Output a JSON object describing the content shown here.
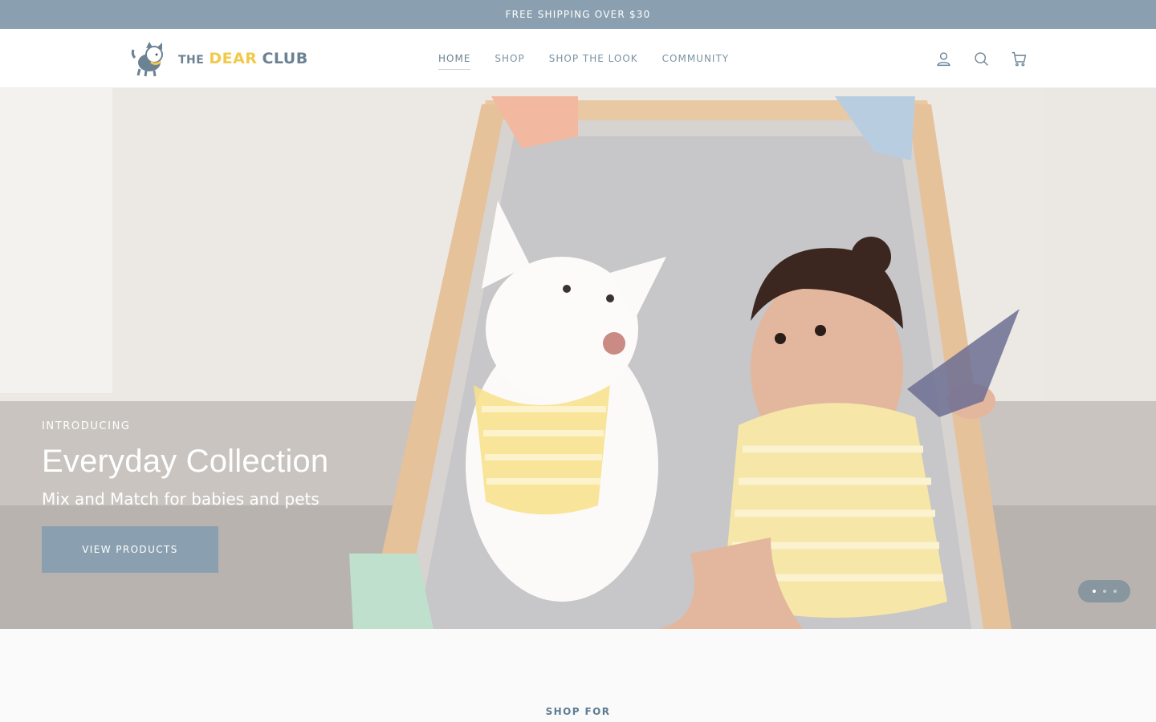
{
  "announcement": {
    "text": "FREE SHIPPING OVER $30"
  },
  "brand": {
    "the": "THE",
    "dear": "DEAR",
    "club": "CLUB"
  },
  "nav": {
    "items": [
      {
        "label": "HOME",
        "active": true
      },
      {
        "label": "SHOP",
        "active": false
      },
      {
        "label": "SHOP THE LOOK",
        "active": false
      },
      {
        "label": "COMMUNITY",
        "active": false
      }
    ]
  },
  "header_icons": [
    "account-icon",
    "search-icon",
    "cart-icon"
  ],
  "hero": {
    "kicker": "INTRODUCING",
    "title": "Everyday Collection",
    "subtitle": "Mix and Match for babies and pets",
    "button_label": "VIEW PRODUCTS",
    "slides_total": 3,
    "active_slide": 1
  },
  "section": {
    "label": "SHOP FOR"
  },
  "colors": {
    "accent": "#8aa0b0",
    "brand_yellow": "#f2c94c",
    "text_blue": "#6b8294"
  }
}
